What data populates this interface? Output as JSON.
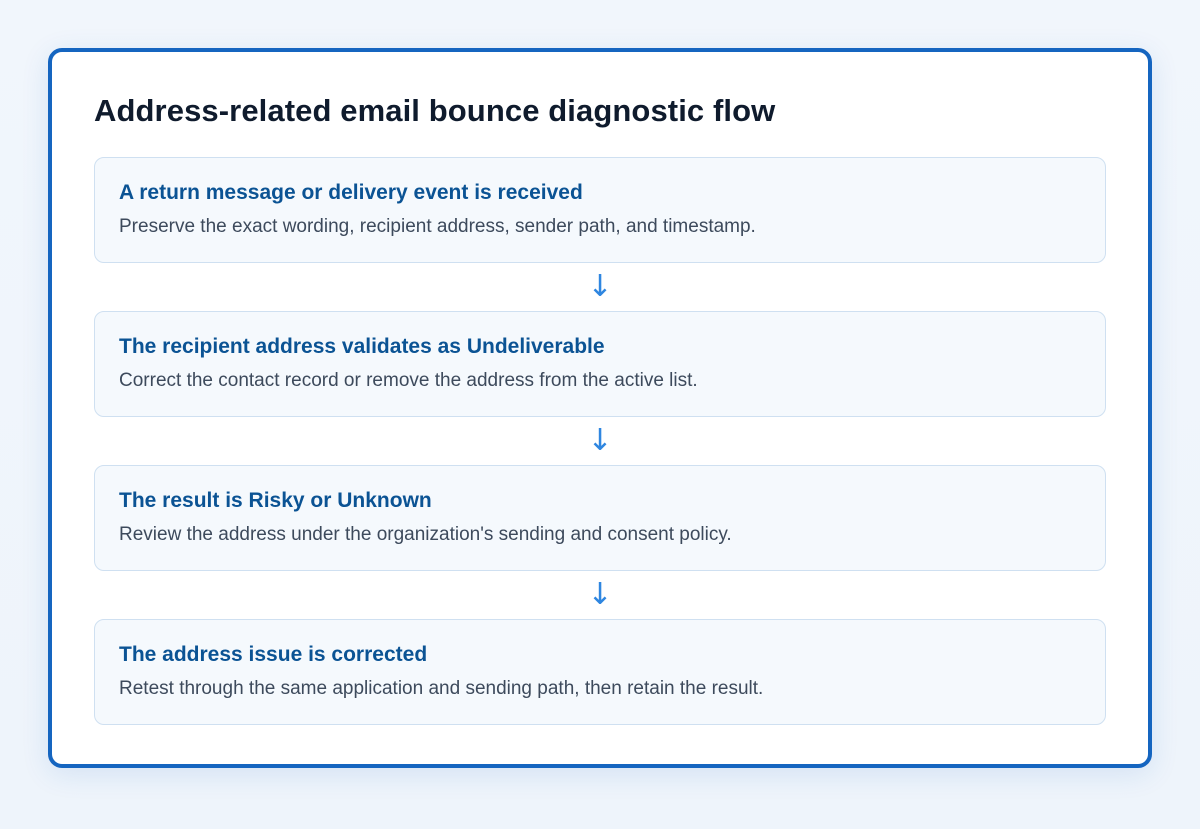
{
  "diagram": {
    "title": "Address-related email bounce diagnostic flow",
    "arrow_glyph": "↓",
    "steps": [
      {
        "title": "A return message or delivery event is received",
        "description": "Preserve the exact wording, recipient address, sender path, and timestamp."
      },
      {
        "title": "The recipient address validates as Undeliverable",
        "description": "Correct the contact record or remove the address from the active list."
      },
      {
        "title": "The result is Risky or Unknown",
        "description": "Review the address under the organization's sending and consent policy."
      },
      {
        "title": "The address issue is corrected",
        "description": "Retest through the same application and sending path, then retain the result."
      }
    ]
  },
  "colors": {
    "frame_border": "#1565c0",
    "step_title": "#0b5394",
    "arrow": "#2f86e0",
    "page_title": "#0f1b2d"
  }
}
